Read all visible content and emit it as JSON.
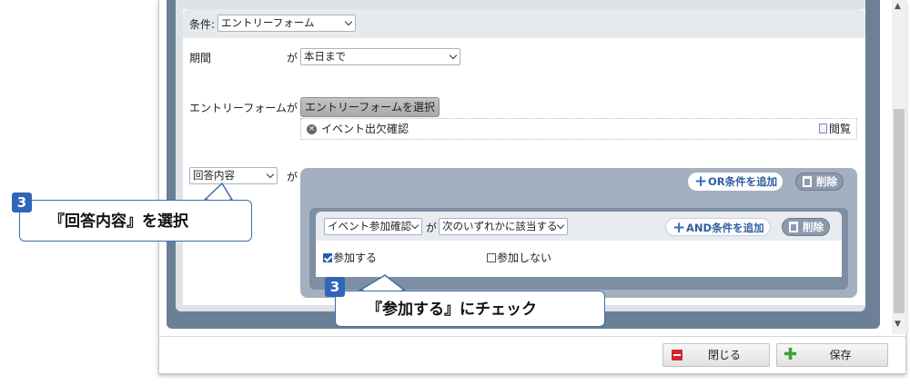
{
  "condition": {
    "label": "条件:",
    "value": "エントリーフォーム"
  },
  "period": {
    "label": "期間",
    "ga": "が",
    "value": "本日まで"
  },
  "entry_form": {
    "label": "エントリーフォーム",
    "ga": "が",
    "select_button": "エントリーフォームを選択",
    "selected_form": "イベント出欠確認",
    "view_label": "閲覧"
  },
  "answer": {
    "select_value": "回答内容",
    "ga": "が"
  },
  "or_group": {
    "add_button": "OR条件を追加",
    "delete_button": "削除"
  },
  "and_group": {
    "question_select": "イベント参加確認",
    "ga": "が",
    "match_select": "次のいずれかに該当する",
    "add_button": "AND条件を追加",
    "delete_button": "削除",
    "options": [
      {
        "label": "参加する",
        "checked": true
      },
      {
        "label": "参加しない",
        "checked": false
      }
    ]
  },
  "footer": {
    "close_label": "閉じる",
    "save_label": "保存"
  },
  "callouts": [
    {
      "number": "3",
      "text": "『回答内容』を選択"
    },
    {
      "number": "3",
      "text": "『参加する』にチェック"
    }
  ],
  "colors": {
    "accent": "#2f67b5",
    "close_icon": "#d8202f",
    "save_icon": "#3aa43a"
  }
}
